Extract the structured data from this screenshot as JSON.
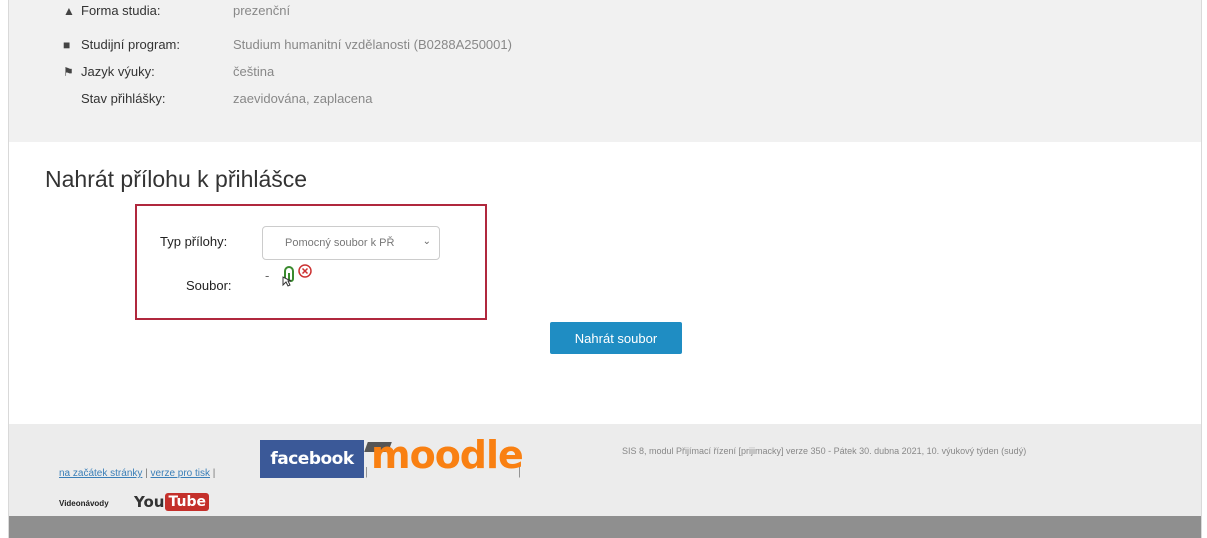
{
  "application": {
    "rows": [
      {
        "icon": "graduation-cap-icon",
        "label": "Forma studia:",
        "value": "prezenční"
      },
      {
        "icon": "book-icon",
        "label": "Studijní program:",
        "value": "Studium humanitní vzdělanosti (B0288A250001)"
      },
      {
        "icon": "flag-icon",
        "label": "Jazyk výuky:",
        "value": "čeština"
      },
      {
        "icon": "",
        "label": "Stav přihlášky:",
        "value": "zaevidována, zaplacena"
      }
    ]
  },
  "upload": {
    "title": "Nahrát přílohu k přihlášce",
    "type_label": "Typ přílohy:",
    "type_selected": "Pomocný soubor k PŘ",
    "file_label": "Soubor:",
    "file_value": "-",
    "button_label": "Nahrát soubor"
  },
  "footer": {
    "link_top": "na začátek stránky",
    "link_print": "verze pro tisk",
    "separator": "|",
    "facebook": "facebook",
    "moodle": "moodle",
    "sis_info": "SIS 8, modul Přijímací řízení [prijimacky] verze 350 - Pátek 30. dubna 2021, 10. výukový týden (sudý)",
    "video_label": "Videonávody",
    "youtube_you": "You",
    "youtube_tube": "Tube"
  },
  "colors": {
    "highlight_border": "#b0283d",
    "button_bg": "#1f8dc3",
    "facebook_bg": "#3b5998",
    "moodle_orange": "#f98012",
    "youtube_red": "#c4302b"
  }
}
